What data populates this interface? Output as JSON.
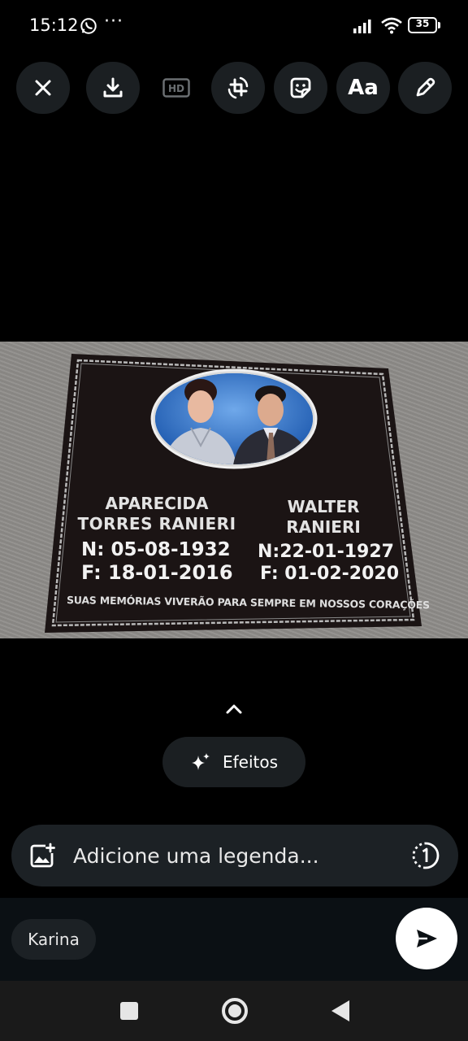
{
  "status_bar": {
    "time": "15:12",
    "more": "···",
    "battery": "35"
  },
  "toolbar": {
    "icons": [
      "close-icon",
      "download-icon",
      "hd-icon",
      "crop-rotate-icon",
      "sticker-icon",
      "text-icon",
      "pencil-icon"
    ],
    "text_label": "Aa",
    "hd_label": "HD"
  },
  "photo": {
    "left_name_line1": "APARECIDA",
    "left_name_line2": "TORRES RANIERI",
    "left_birth": "N: 05-08-1932",
    "left_death": "F: 18-01-2016",
    "right_name_line1": "WALTER",
    "right_name_line2": "RANIERI",
    "right_birth": "N:22-01-1927",
    "right_death": "F: 01-02-2020",
    "epitaph": "SUAS MEMÓRIAS VIVERÃO PARA SEMPRE EM NOSSOS CORAÇÕES"
  },
  "effects": {
    "label": "Efeitos"
  },
  "caption": {
    "placeholder": "Adicione uma legenda..."
  },
  "recipient": {
    "name": "Karina"
  },
  "colors": {
    "background": "#000000",
    "button_bg": "#1b1f22",
    "caption_bg": "#1c2125",
    "send_bg": "#ffffff"
  }
}
